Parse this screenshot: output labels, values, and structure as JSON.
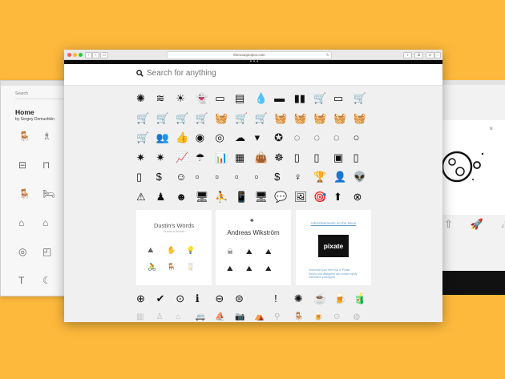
{
  "left_window": {
    "search_label": "Search",
    "title": "Home",
    "byline": "by Sergey Demushkin",
    "icons": [
      "🪑",
      "♗",
      "⊟",
      "⊓",
      "🪑",
      "🛏",
      "⌂",
      "⌂",
      "◎",
      "◰",
      "T",
      "☾"
    ]
  },
  "right_window": {
    "close_label": "×",
    "icons": [
      "⇧",
      "🚀",
      "☄"
    ]
  },
  "browser": {
    "url": "thenounproject.com",
    "reload": "↻",
    "back": "‹",
    "forward": "›",
    "sidebar": "▭",
    "share": "⇧",
    "tabs": "⧉",
    "settings": "⚙",
    "add": "+",
    "page_dots": "• • •"
  },
  "search": {
    "placeholder": "Search for anything"
  },
  "icon_grid": {
    "rows": [
      [
        "✺",
        "≋",
        "☀",
        "👻",
        "▭",
        "▤",
        "💧",
        "▬",
        "▮▮",
        "🛒",
        "▭",
        "🛒"
      ],
      [
        "🛒",
        "🛒",
        "🛒",
        "🛒",
        "🧺",
        "🛒",
        "🛒",
        "🧺",
        "🧺",
        "🧺",
        "🧺",
        "🧺"
      ],
      [
        "🛒",
        "👥",
        "👍",
        "◉",
        "◎",
        "☁",
        "▾",
        "✪",
        "◌",
        "◌",
        "◌",
        "○"
      ],
      [
        "✷",
        "✷",
        "📈",
        "☂",
        "📊",
        "▦",
        "👜",
        "☸",
        "▯",
        "▯",
        "▣",
        "▯"
      ],
      [
        "▯",
        "$",
        "☺",
        "▫",
        "▫",
        "▫",
        "▫",
        "$",
        "♀",
        "🏆",
        "👤",
        "👽"
      ],
      [
        "⚠",
        "♟",
        "☻",
        "🖥",
        "⛹",
        "📱",
        "🖥",
        "💬",
        "🖼",
        "🎯",
        "⬆",
        "⊗"
      ]
    ]
  },
  "cards": [
    {
      "title": "Dustin's Words",
      "subtitle": "Dustin's Words",
      "icons": [
        "⛰",
        "✋",
        "💡",
        "🚴",
        "🪑",
        "🥛"
      ]
    },
    {
      "badge": "♣",
      "title": "Andreas Wikström",
      "icons": [
        "☠",
        "⛰",
        "⛰",
        "⛰",
        "⛰",
        "⛰"
      ]
    },
    {
      "link": "Advertisements on the Noun",
      "ad_label": "pixate",
      "ad_text": "Download your free trial of Pixate Studio and designers can create highly interactive prototypes"
    }
  ],
  "bottom_row": [
    "⊕",
    "✔",
    "⊙",
    "ℹ",
    "⊖",
    "⊜",
    "",
    "!",
    "✺",
    "☕",
    "🍺",
    "🧃"
  ],
  "faded_row": [
    "▥",
    "♙",
    "⌂",
    "🚐",
    "⛵",
    "📷",
    "⛺",
    "⚲",
    "🪑",
    "🍺",
    "⊙",
    "◍"
  ]
}
